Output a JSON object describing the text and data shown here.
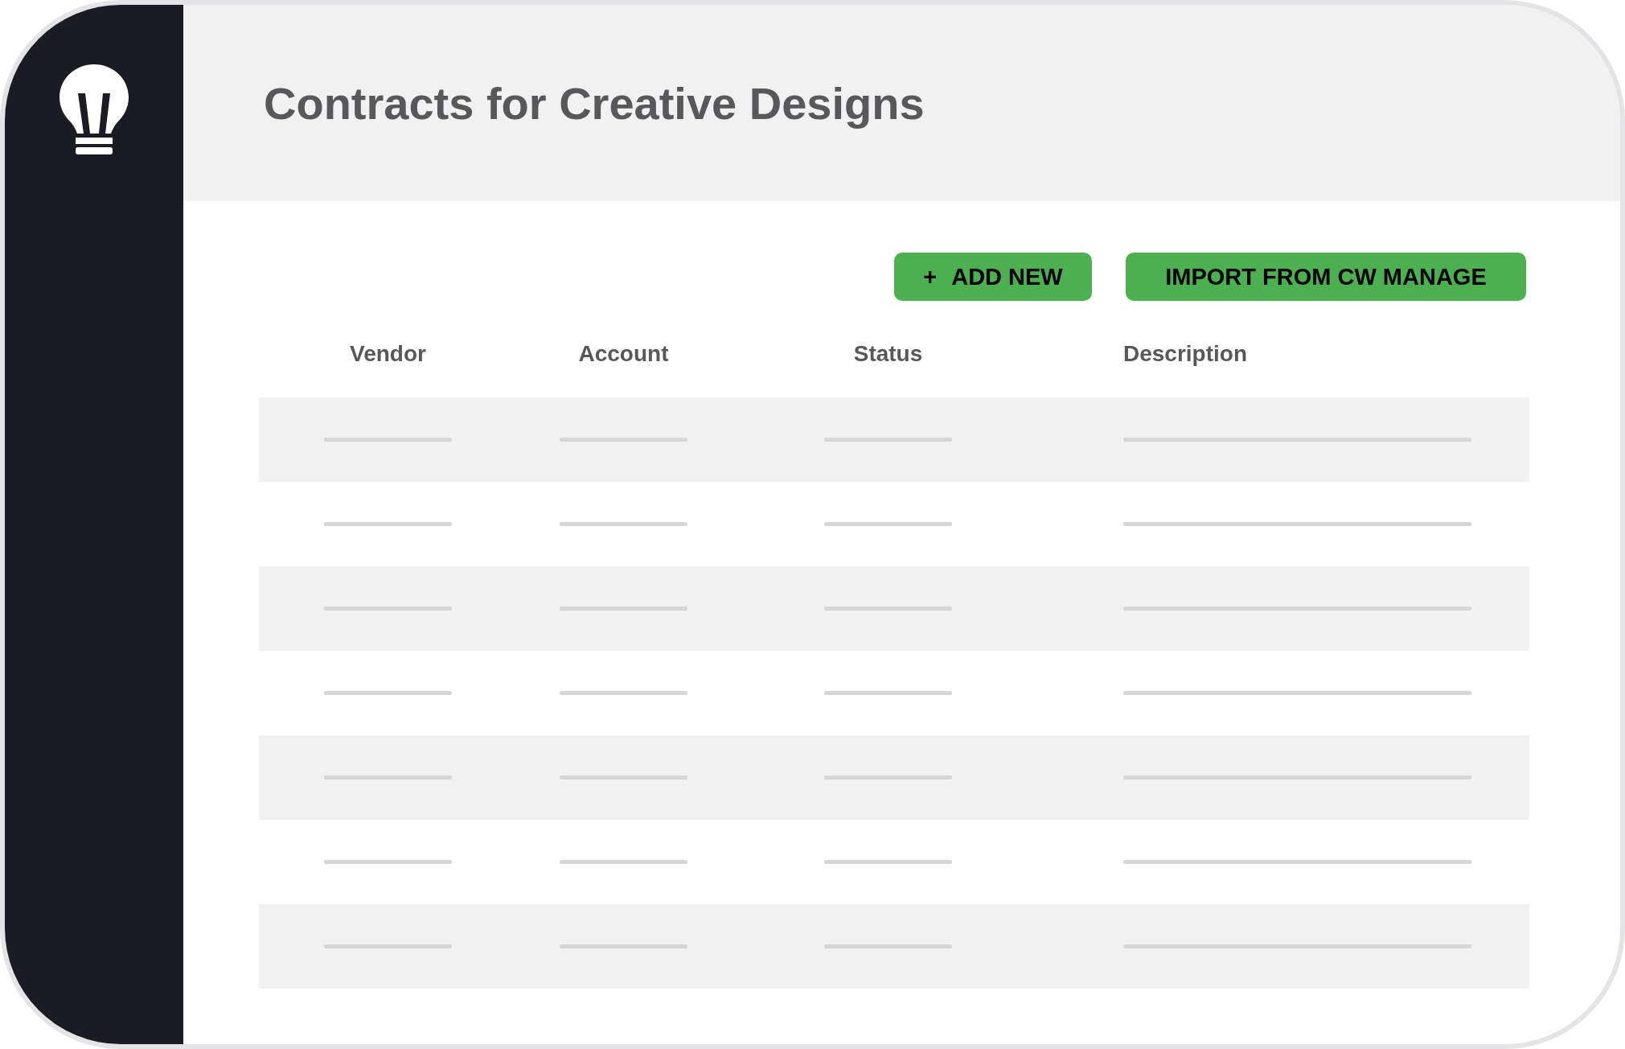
{
  "header": {
    "title": "Contracts for Creative Designs"
  },
  "actions": [
    {
      "icon": "+",
      "label": "ADD NEW"
    },
    {
      "label": "IMPORT FROM CW MANAGE"
    }
  ],
  "table": {
    "columns": [
      "Vendor",
      "Account",
      "Status",
      "Description"
    ],
    "rows": [
      {
        "kind": "placeholder"
      },
      {
        "kind": "placeholder"
      },
      {
        "kind": "placeholder"
      },
      {
        "kind": "placeholder"
      },
      {
        "kind": "placeholder"
      },
      {
        "kind": "placeholder"
      },
      {
        "kind": "placeholder"
      }
    ]
  }
}
